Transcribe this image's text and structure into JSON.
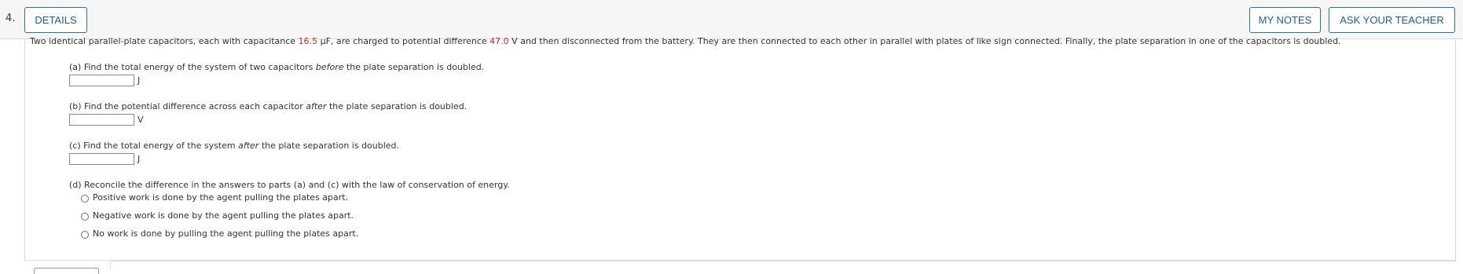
{
  "question": {
    "number": "4.",
    "buttons": {
      "details": "DETAILS",
      "my_notes": "MY NOTES",
      "ask_teacher": "ASK YOUR TEACHER"
    },
    "stem": {
      "part1": "Two identical parallel-plate capacitors, each with capacitance ",
      "capacitance_value": "16.5",
      "part2": " µF, are charged to potential difference ",
      "voltage_value": "47.0",
      "part3": " V and then disconnected from the battery. They are then connected to each other in parallel with plates of like sign connected. Finally, the plate separation in one of the capacitors is doubled."
    },
    "parts": {
      "a": {
        "pre": "(a) Find the total energy of the system of two capacitors ",
        "em": "before",
        "post": " the plate separation is doubled.",
        "unit": "J",
        "value": ""
      },
      "b": {
        "pre": "(b) Find the potential difference across each capacitor ",
        "em": "after",
        "post": " the plate separation is doubled.",
        "unit": "V",
        "value": ""
      },
      "c": {
        "pre": "(c) Find the total energy of the system ",
        "em": "after",
        "post": " the plate separation is doubled.",
        "unit": "J",
        "value": ""
      },
      "d": {
        "prompt": "(d) Reconcile the difference in the answers to parts (a) and (c) with the law of conservation of energy.",
        "options": [
          "Positive work is done by the agent pulling the plates apart.",
          "Negative work is done by the agent pulling the plates apart.",
          "No work is done by pulling the agent pulling the plates apart."
        ]
      }
    }
  },
  "colors": {
    "accent": "#1f5e8f",
    "given_value": "#d9232d"
  }
}
